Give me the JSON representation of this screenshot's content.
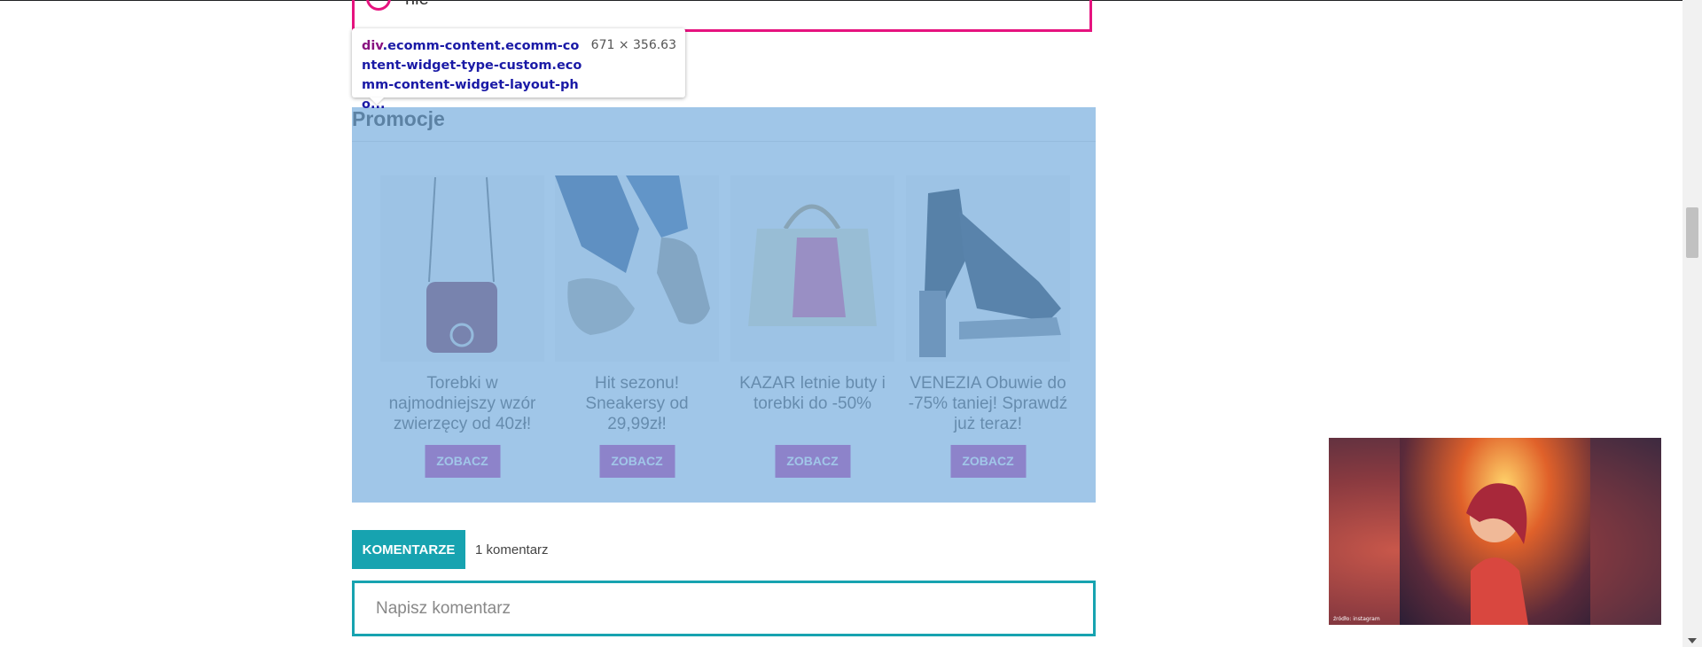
{
  "poll": {
    "option_label": "nie"
  },
  "devtools_tooltip": {
    "tag": "div",
    "selector": ".ecomm-content.ecomm-content-widget-type-custom.ecomm-content-widget-layout-pho...",
    "dimensions": "671 × 356.63"
  },
  "promo": {
    "title": "Promocje",
    "items": [
      {
        "text": "Torebki w najmodniejszy wzór zwierzęcy od 40zł!",
        "button": "ZOBACZ",
        "icon": "handbag-image"
      },
      {
        "text": "Hit sezonu! Sneakersy od 29,99zł!",
        "button": "ZOBACZ",
        "icon": "sneakers-image"
      },
      {
        "text": "KAZAR letnie buty i torebki do -50%",
        "button": "ZOBACZ",
        "icon": "tote-bag-image"
      },
      {
        "text": "VENEZIA Obuwie do -75% taniej! Sprawdź już teraz!",
        "button": "ZOBACZ",
        "icon": "sandal-image"
      }
    ]
  },
  "comments": {
    "button_label": "KOMENTARZE",
    "count_label": "1 komentarz",
    "input_placeholder": "Napisz komentarz"
  },
  "video": {
    "caption": "źródło: instagram"
  },
  "colors": {
    "accent_pink": "#e6137f",
    "button_purple": "#c63ca8",
    "accent_teal": "#17a3b0",
    "highlight_overlay": "#6fa8dc"
  }
}
